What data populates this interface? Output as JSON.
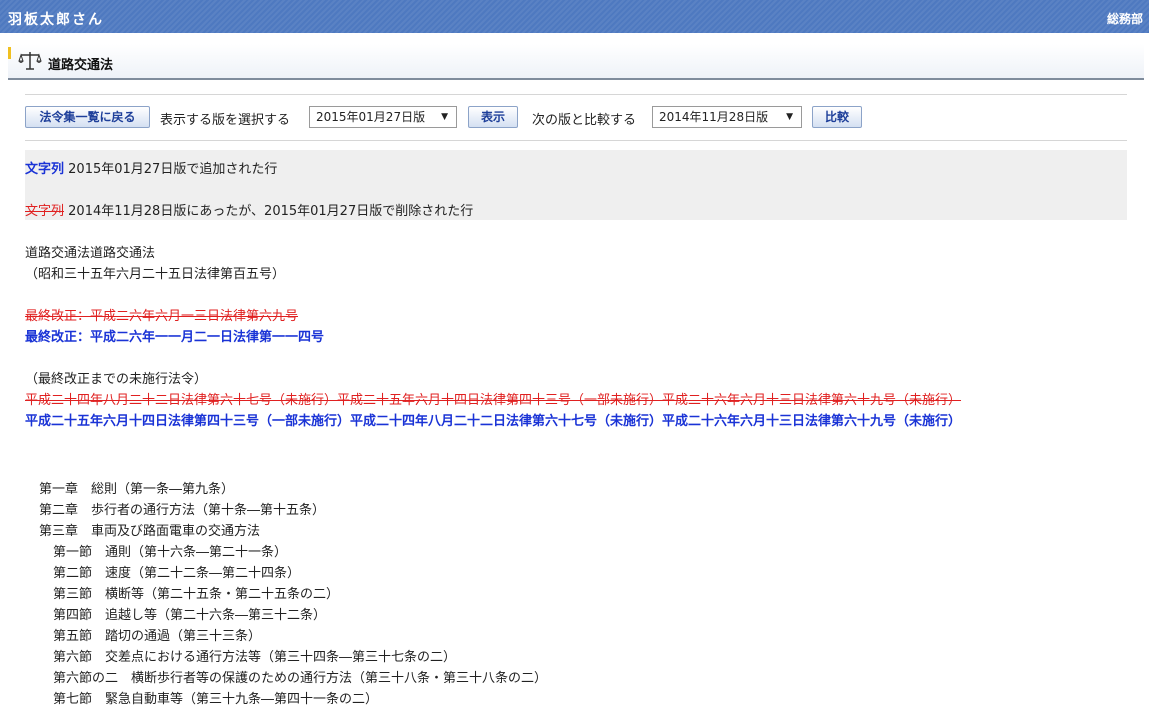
{
  "user_bar": {
    "user_name": "羽板太郎さん",
    "department": "総務部"
  },
  "app_header": {
    "title": "道路交通法",
    "icon": "scale-icon",
    "accent_color": "#f0c020"
  },
  "toolbar": {
    "back_button": "法令集一覧に戻る",
    "select_version_label": "表示する版を選択する",
    "selected_version": "2015年01月27日版",
    "show_button": "表示",
    "compare_label": "次の版と比較する",
    "compare_version": "2014年11月28日版",
    "compare_button": "比較"
  },
  "legend": {
    "added_marker": "文字列",
    "added_text": " 2015年01月27日版で追加された行",
    "deleted_marker": "文字列",
    "deleted_text": " 2014年11月28日版にあったが、2015年01月27日版で削除された行",
    "added_color": "#1a33d6",
    "deleted_color": "#e02020"
  },
  "law": {
    "title": "道路交通法道路交通法",
    "number": "（昭和三十五年六月二十五日法律第百五号）",
    "last_amend_deleted": "最終改正：平成二六年六月一三日法律第六九号",
    "last_amend_added": "最終改正：平成二六年一一月二一日法律第一一四号",
    "unenforced_label": "（最終改正までの未施行法令）",
    "unenforced_deleted": "平成二十四年八月二十二日法律第六十七号（未施行）平成二十五年六月十四日法律第四十三号（一部未施行）平成二十六年六月十三日法律第六十九号（未施行）",
    "unenforced_added": "平成二十五年六月十四日法律第四十三号（一部未施行）平成二十四年八月二十二日法律第六十七号（未施行）平成二十六年六月十三日法律第六十九号（未施行）"
  },
  "toc": [
    {
      "text": "第一章　総則（第一条―第九条）",
      "indent": 0
    },
    {
      "text": "第二章　歩行者の通行方法（第十条―第十五条）",
      "indent": 0
    },
    {
      "text": "第三章　車両及び路面電車の交通方法",
      "indent": 0
    },
    {
      "text": "第一節　通則（第十六条―第二十一条）",
      "indent": 1
    },
    {
      "text": "第二節　速度（第二十二条―第二十四条）",
      "indent": 1
    },
    {
      "text": "第三節　横断等（第二十五条・第二十五条の二）",
      "indent": 1
    },
    {
      "text": "第四節　追越し等（第二十六条―第三十二条）",
      "indent": 1
    },
    {
      "text": "第五節　踏切の通過（第三十三条）",
      "indent": 1
    },
    {
      "text": "第六節　交差点における通行方法等（第三十四条―第三十七条の二）",
      "indent": 1
    },
    {
      "text": "第六節の二　横断歩行者等の保護のための通行方法（第三十八条・第三十八条の二）",
      "indent": 1
    },
    {
      "text": "第七節　緊急自動車等（第三十九条―第四十一条の二）",
      "indent": 1
    }
  ]
}
